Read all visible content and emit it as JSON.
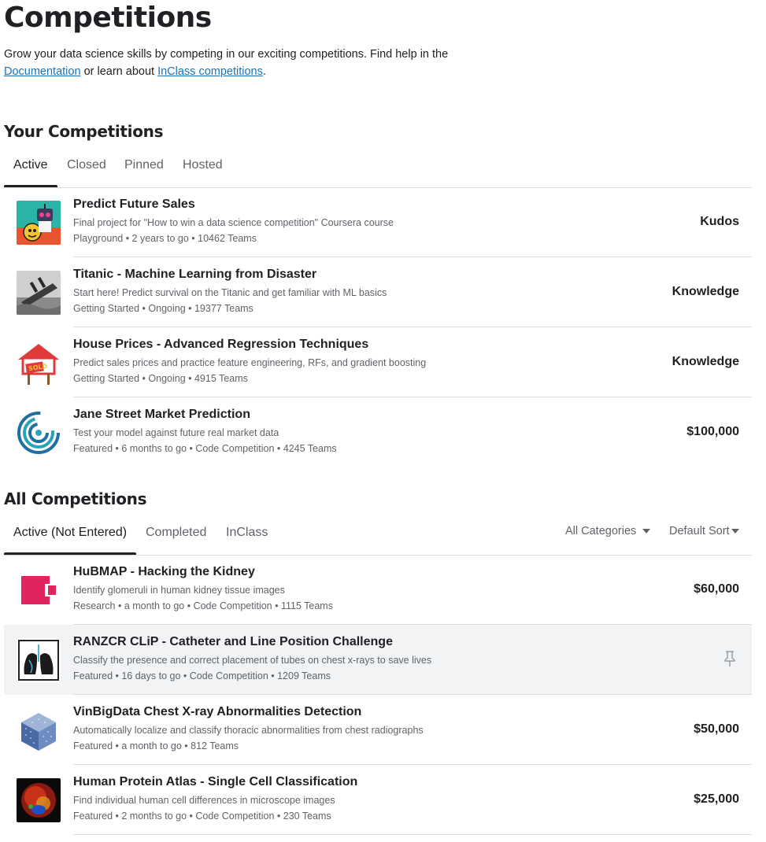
{
  "header": {
    "title": "Competitions",
    "intro_text": "Grow your data science skills by competing in our exciting competitions. Find help in the",
    "doc_link": "Documentation",
    "intro_mid": "or learn about",
    "inclass_link": "InClass competitions",
    "intro_end": "."
  },
  "your_competitions": {
    "title": "Your Competitions",
    "tabs": [
      {
        "label": "Active"
      },
      {
        "label": "Closed"
      },
      {
        "label": "Pinned"
      },
      {
        "label": "Hosted"
      }
    ],
    "items": [
      {
        "title": "Predict Future Sales",
        "description": "Final project for \"How to win a data science competition\" Coursera course",
        "meta": "Playground • 2 years to go • 10462 Teams",
        "reward": "Kudos",
        "icon": "robot-thumbnail"
      },
      {
        "title": "Titanic - Machine Learning from Disaster",
        "description": "Start here! Predict survival on the Titanic and get familiar with ML basics",
        "meta": "Getting Started • Ongoing • 19377 Teams",
        "reward": "Knowledge",
        "icon": "titanic-ship-thumbnail"
      },
      {
        "title": "House Prices - Advanced Regression Techniques",
        "description": "Predict sales prices and practice feature engineering, RFs, and gradient boosting",
        "meta": "Getting Started • Ongoing • 4915 Teams",
        "reward": "Knowledge",
        "icon": "house-sold-thumbnail"
      },
      {
        "title": "Jane Street Market Prediction",
        "description": "Test your model against future real market data",
        "meta": "Featured • 6 months to go • Code Competition • 4245 Teams",
        "reward": "$100,000",
        "icon": "jane-street-logo-thumbnail"
      }
    ]
  },
  "all_competitions": {
    "title": "All Competitions",
    "tabs": [
      {
        "label": "Active (Not Entered)"
      },
      {
        "label": "Completed"
      },
      {
        "label": "InClass"
      }
    ],
    "category_filter": "All Categories",
    "sort": "Default Sort",
    "items": [
      {
        "title": "HuBMAP - Hacking the Kidney",
        "description": "Identify glomeruli in human kidney tissue images",
        "meta": "Research • a month to go • Code Competition • 1115 Teams",
        "reward": "$60,000",
        "icon": "hubmap-logo-thumbnail"
      },
      {
        "title": "RANZCR CLiP - Catheter and Line Position Challenge",
        "description": "Classify the presence and correct placement of tubes on chest x-rays to save lives",
        "meta": "Featured • 16 days to go • Code Competition • 1209 Teams",
        "reward": "",
        "icon": "lungs-thumbnail"
      },
      {
        "title": "VinBigData Chest X-ray Abnormalities Detection",
        "description": "Automatically localize and classify thoracic abnormalities from chest radiographs",
        "meta": "Featured • a month to go • 812 Teams",
        "reward": "$50,000",
        "icon": "dotted-cube-thumbnail"
      },
      {
        "title": "Human Protein Atlas - Single Cell Classification",
        "description": "Find individual human cell differences in microscope images",
        "meta": "Featured • 2 months to go • Code Competition • 230 Teams",
        "reward": "$25,000",
        "icon": "cell-microscopy-thumbnail"
      }
    ]
  }
}
